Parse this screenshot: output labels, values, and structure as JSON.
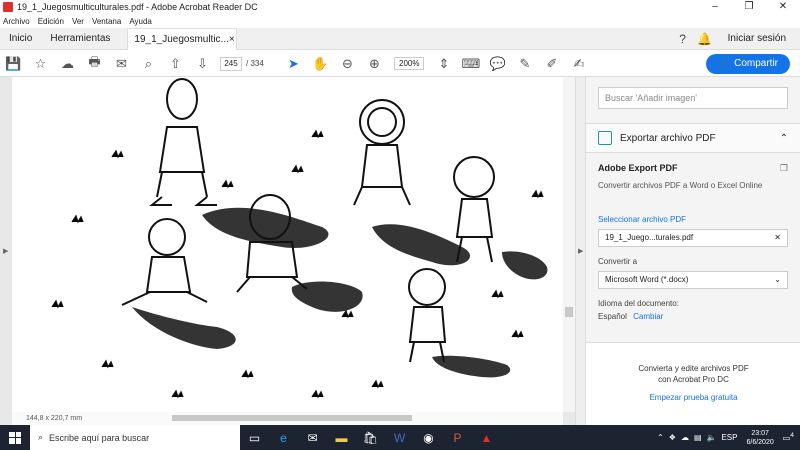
{
  "window": {
    "title": "19_1_Juegosmulticulturales.pdf - Adobe Acrobat Reader DC",
    "controls": [
      "–",
      "❐",
      "✕"
    ]
  },
  "menu": [
    "Archivo",
    "Edición",
    "Ver",
    "Ventana",
    "Ayuda"
  ],
  "tabs": {
    "home": "Inicio",
    "tools": "Herramientas",
    "doc": "19_1_Juegosmultic...",
    "close": "×"
  },
  "account": {
    "signin": "Iniciar sesión"
  },
  "toolbar": {
    "page_current": "245",
    "page_sep": "/",
    "page_total": "334",
    "zoom": "200%",
    "share": "Compartir"
  },
  "document": {
    "dimensions": "144,8 x 220,7 mm"
  },
  "panel": {
    "search_placeholder": "Buscar 'Añadir imagen'",
    "export_title": "Exportar archivo PDF",
    "export_heading": "Adobe Export PDF",
    "export_desc": "Convertir archivos PDF a Word o Excel Online",
    "select_label": "Seleccionar archivo PDF",
    "selected_file": "19_1_Juego...turales.pdf",
    "convert_label": "Convertir a",
    "convert_value": "Microsoft Word (*.docx)",
    "language_label": "Idioma del documento:",
    "language_value": "Español",
    "language_change": "Cambiar",
    "promo_text_1": "Convierta y edite archivos PDF",
    "promo_text_2": "con Acrobat Pro DC",
    "promo_link": "Empezar prueba gratuita"
  },
  "taskbar": {
    "search_placeholder": "Escribe aquí para buscar",
    "lang": "ESP",
    "time": "23:07",
    "date": "6/6/2020",
    "notif_count": "4"
  },
  "colors": {
    "accent": "#1473e6",
    "taskbar": "#1c2331"
  }
}
